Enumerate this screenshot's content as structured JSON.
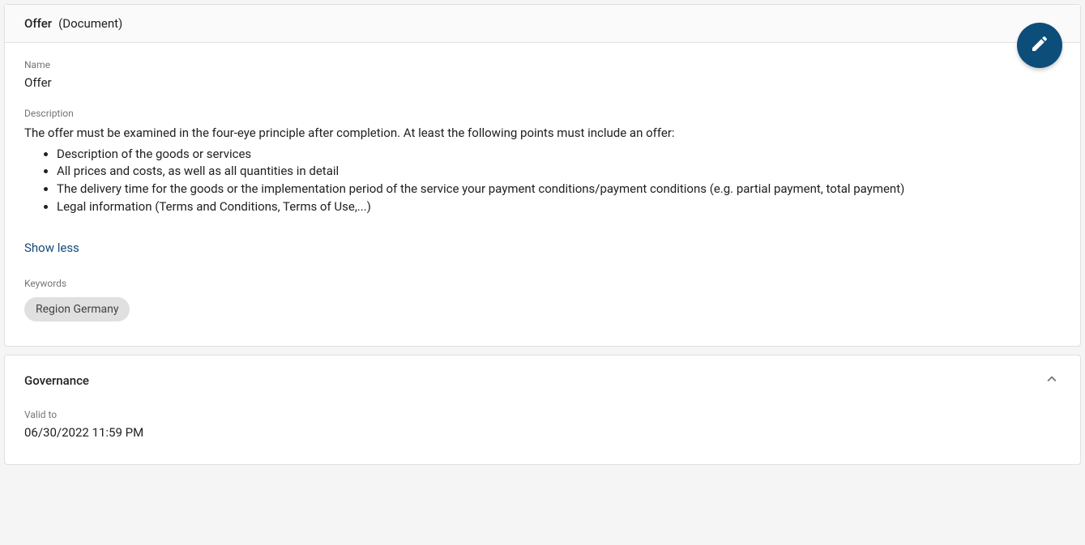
{
  "header": {
    "title": "Offer",
    "type": "(Document)"
  },
  "fields": {
    "name_label": "Name",
    "name_value": "Offer",
    "description_label": "Description",
    "description_intro": "The offer must be examined in the four-eye principle after completion. At least the following points must include an offer:",
    "description_items": [
      "Description of the goods or services",
      "All prices and costs, as well as all quantities in detail",
      "The delivery time for the goods or the implementation period of the service your payment conditions/payment conditions (e.g. partial payment, total payment)",
      "Legal information (Terms and Conditions, Terms of Use,...)"
    ],
    "show_less": "Show less",
    "keywords_label": "Keywords",
    "keywords": [
      "Region Germany"
    ]
  },
  "governance": {
    "title": "Governance",
    "valid_to_label": "Valid to",
    "valid_to_value": "06/30/2022 11:59 PM"
  }
}
